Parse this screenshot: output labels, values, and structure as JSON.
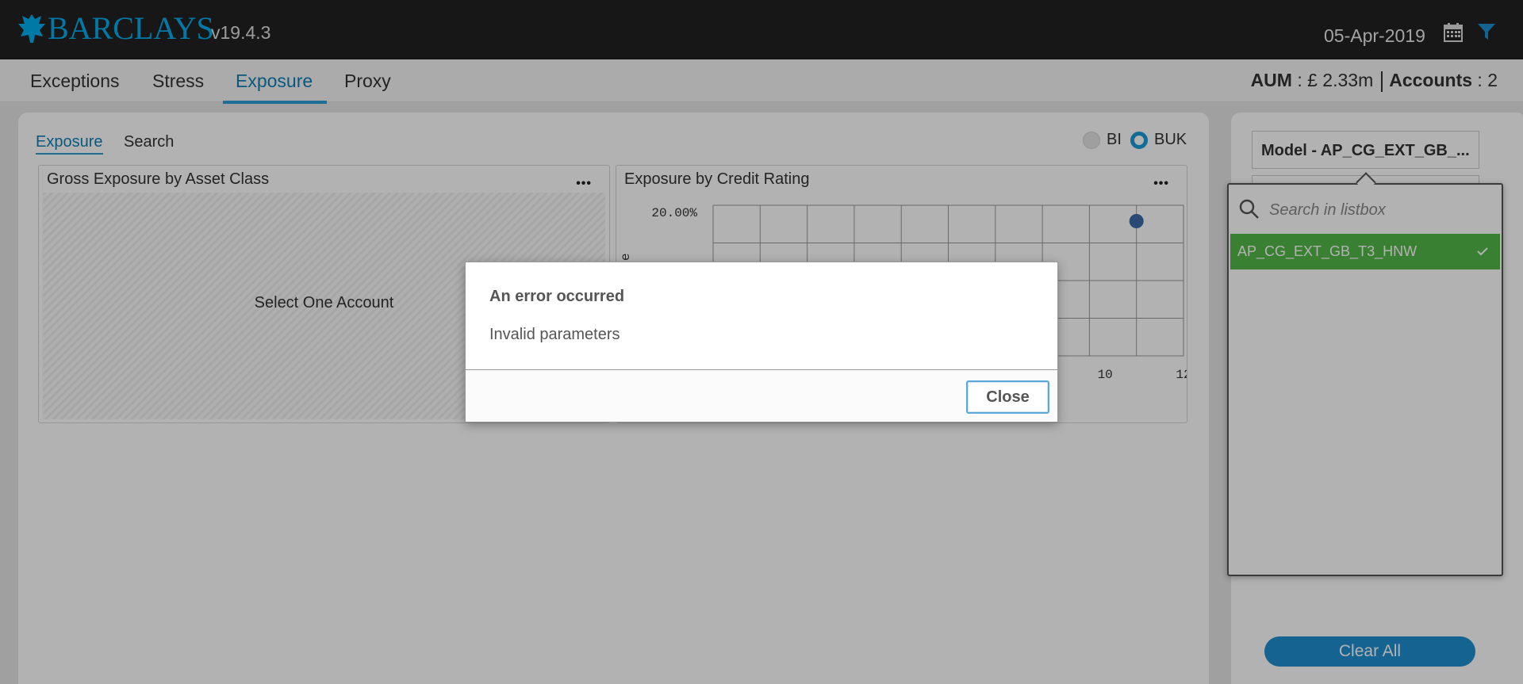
{
  "header": {
    "brand": "BARCLAYS",
    "version": "v19.4.3",
    "date": "05-Apr-2019",
    "icons": [
      "eagle-logo-icon",
      "calendar-icon",
      "filter-icon"
    ],
    "brand_color": "#00aeef"
  },
  "nav": {
    "items": [
      {
        "label": "Exceptions"
      },
      {
        "label": "Stress"
      },
      {
        "label": "Exposure"
      },
      {
        "label": "Proxy"
      }
    ],
    "active": "Exposure",
    "aum_label": "AUM",
    "aum_value": ": £ 2.33m",
    "accounts_label": "Accounts",
    "accounts_value": ": 2"
  },
  "main": {
    "tabs": [
      {
        "label": "Exposure"
      },
      {
        "label": "Search"
      }
    ],
    "radios": [
      {
        "label": "BI",
        "selected": false
      },
      {
        "label": "BUK",
        "selected": true
      }
    ],
    "cards": {
      "gross": {
        "title": "Gross Exposure by Asset Class",
        "placeholder": "Select One Account",
        "menu": "•••"
      },
      "credit": {
        "title": "Exposure by Credit Rating",
        "menu": "•••"
      }
    }
  },
  "chart_data": {
    "type": "scatter",
    "title": "Exposure by Credit Rating",
    "ylabel": "e",
    "y_tick_labels": [
      "20.00%"
    ],
    "x_tick_labels": [
      "10",
      "12"
    ],
    "xlim": [
      0,
      12
    ],
    "grid": true,
    "series": [
      {
        "points": [
          {
            "x": 10.8,
            "y": 20.0
          }
        ],
        "color": "#3a6aa8"
      }
    ]
  },
  "sidebar": {
    "model_label": "Model - AP_CG_EXT_GB_...",
    "search_placeholder": "Search in listbox",
    "list_items": [
      {
        "label": "AP_CG_EXT_GB_T3_HNW",
        "selected": true
      }
    ],
    "clear_label": "Clear All",
    "selected_color": "#52b848"
  },
  "dialog": {
    "title": "An error occurred",
    "message": "Invalid parameters",
    "close_label": "Close"
  }
}
